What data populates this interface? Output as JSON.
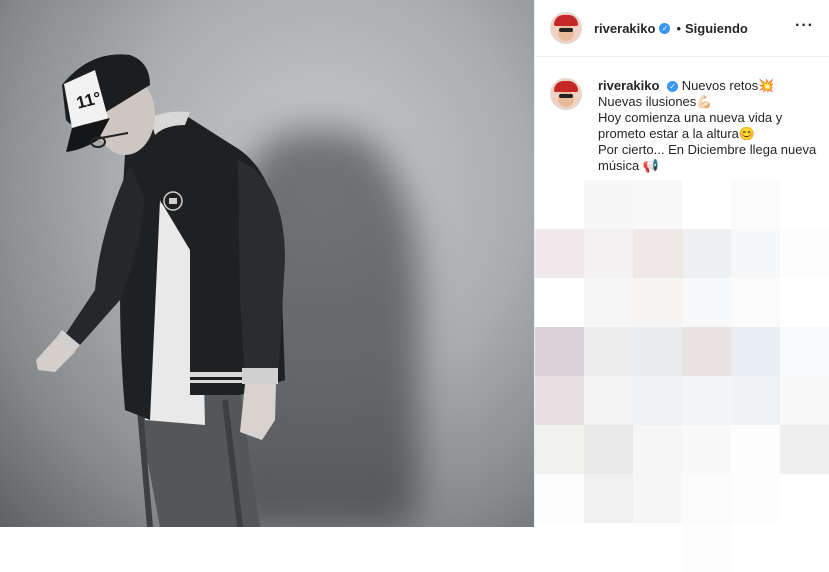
{
  "photo": {
    "alt": ""
  },
  "header": {
    "username": "riverakiko",
    "verified_mark": "✓",
    "separator": "•",
    "follow_status": "Siguiendo",
    "more_icon": "···"
  },
  "caption": {
    "username": "riverakiko",
    "lines": [
      "Nuevos retos💥",
      "Nuevas ilusiones💪🏻",
      "Hoy comienza una nueva vida y",
      "prometo estar a la altura😊",
      "Por cierto... En Diciembre llega nueva",
      "música 📢"
    ]
  },
  "mosaic_colors": [
    "#ffffff",
    "#f7f7f7",
    "#f8f8f8",
    "#ffffff",
    "#fbfbfb",
    "#ffffff",
    "#efe9eb",
    "#f3f1f1",
    "#efe8e6",
    "#eef0f2",
    "#f6f7f8",
    "#fdfdfd",
    "#ffffff",
    "#f6f6f6",
    "#f6f4f2",
    "#f8f9fa",
    "#fbfbfb",
    "#ffffff",
    "#d8d2d6",
    "#ededed",
    "#e9edf0",
    "#e9e4e1",
    "#e8eef4",
    "#f9fafb",
    "#e7e0e3",
    "#f3f3f3",
    "#eef2f4",
    "#f2f4f5",
    "#f0f2f3",
    "#f9f9f9",
    "#f2f2ee",
    "#e9e9e9",
    "#f6f6f6",
    "#f9f9f9",
    "#fdfdfd",
    "#efefef",
    "#fdfdfd",
    "#f1f1f1",
    "#f7f7f7",
    "#fbfbfb",
    "#fdfdfd",
    "#ffffff",
    "#ffffff",
    "#ffffff",
    "#ffffff",
    "#fdfdfd",
    "#ffffff",
    "#ffffff"
  ]
}
